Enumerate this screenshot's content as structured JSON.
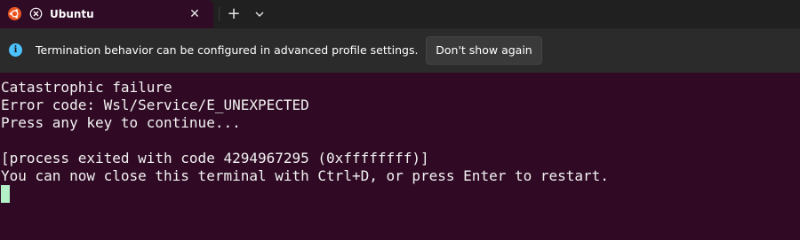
{
  "tab": {
    "title": "Ubuntu",
    "logo_icon": "ubuntu-logo-icon",
    "close_label": "✕",
    "new_tab_label": "+",
    "dropdown_icon": "chevron-down-icon"
  },
  "infobar": {
    "icon": "info-icon",
    "message": "Termination behavior can be configured in advanced profile settings.",
    "button_label": "Don't show again"
  },
  "terminal": {
    "lines": [
      "Catastrophic failure",
      "Error code: Wsl/Service/E_UNEXPECTED",
      "Press any key to continue...",
      "",
      "[process exited with code 4294967295 (0xffffffff)]",
      "You can now close this terminal with Ctrl+D, or press Enter to restart."
    ]
  },
  "colors": {
    "terminal_bg": "#300a24",
    "tabbar_bg": "#202020",
    "infobar_bg": "#2b2b2b",
    "info_accent": "#4cc2ff",
    "ubuntu_orange": "#e95420",
    "cursor": "#b3f0c7"
  }
}
